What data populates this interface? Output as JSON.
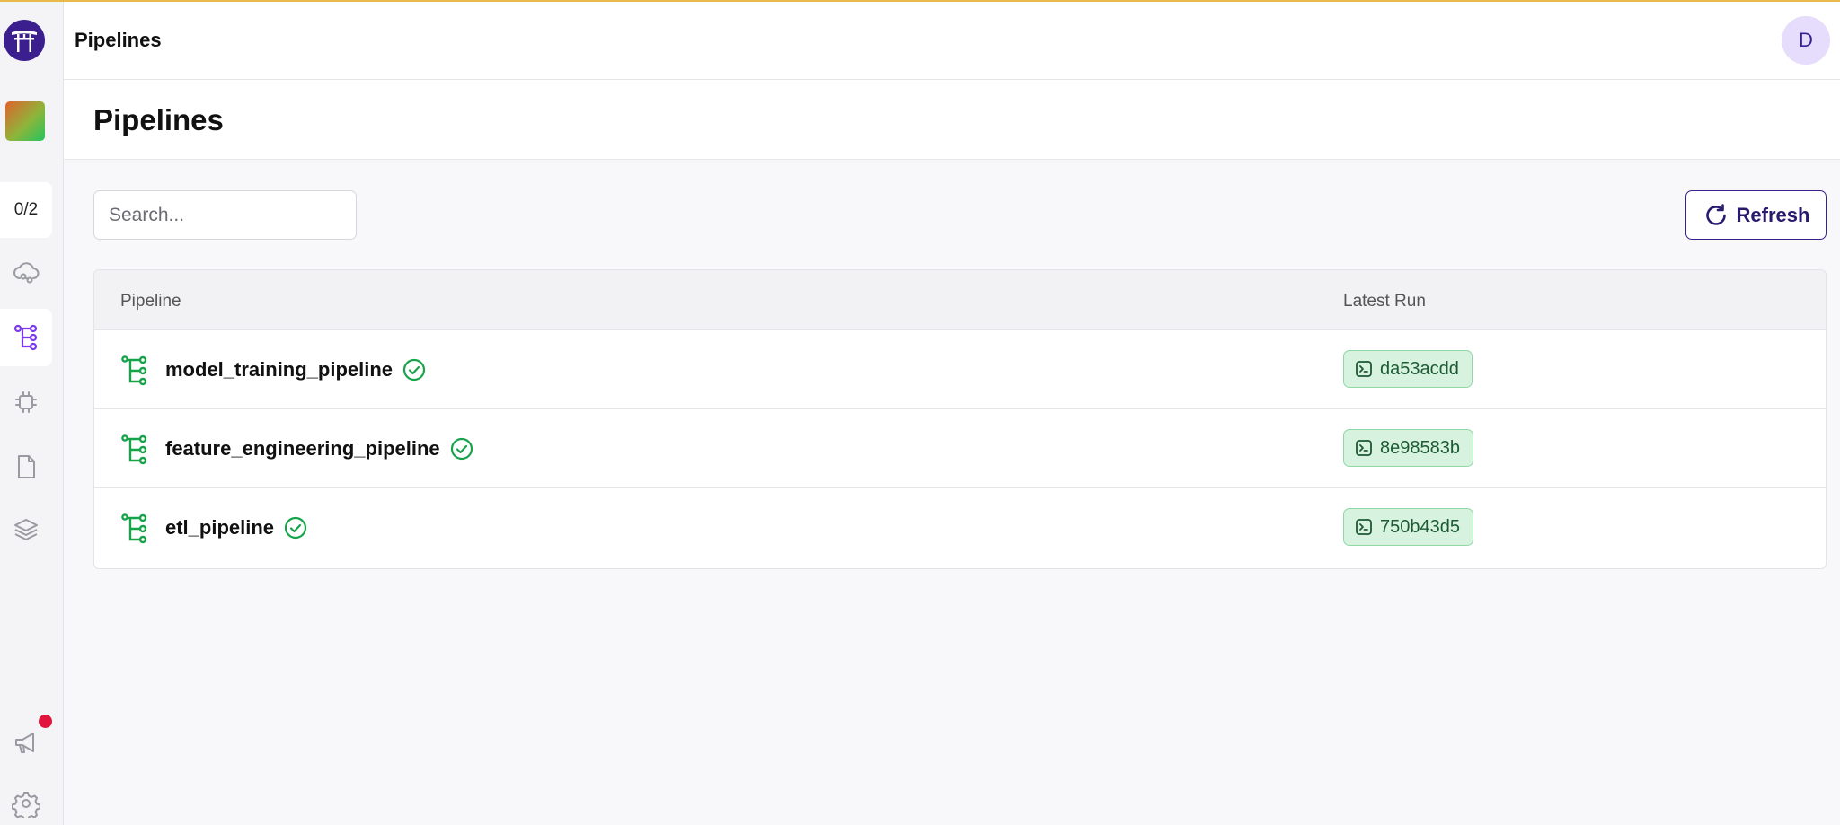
{
  "app": {
    "header_title": "Pipelines",
    "avatar_initial": "D",
    "accent_color": "#3b1f8f",
    "success_color": "#22c55e"
  },
  "sidebar": {
    "onboarding_progress": "0/2",
    "nav_items": [
      {
        "name": "stacks",
        "icon": "cloud-icon"
      },
      {
        "name": "pipelines",
        "icon": "pipeline-icon",
        "active": true
      },
      {
        "name": "components",
        "icon": "chip-icon"
      },
      {
        "name": "models",
        "icon": "file-icon"
      },
      {
        "name": "artifacts",
        "icon": "layers-icon"
      }
    ],
    "bottom_items": [
      {
        "name": "announcements",
        "icon": "megaphone-icon",
        "has_notification": true
      },
      {
        "name": "settings",
        "icon": "gear-icon"
      }
    ]
  },
  "page": {
    "title": "Pipelines",
    "search_placeholder": "Search...",
    "refresh_label": "Refresh"
  },
  "table": {
    "columns": [
      "Pipeline",
      "Latest Run"
    ],
    "rows": [
      {
        "name": "model_training_pipeline",
        "status": "completed",
        "latest_run": "da53acdd"
      },
      {
        "name": "feature_engineering_pipeline",
        "status": "completed",
        "latest_run": "8e98583b"
      },
      {
        "name": "etl_pipeline",
        "status": "completed",
        "latest_run": "750b43d5"
      }
    ]
  }
}
